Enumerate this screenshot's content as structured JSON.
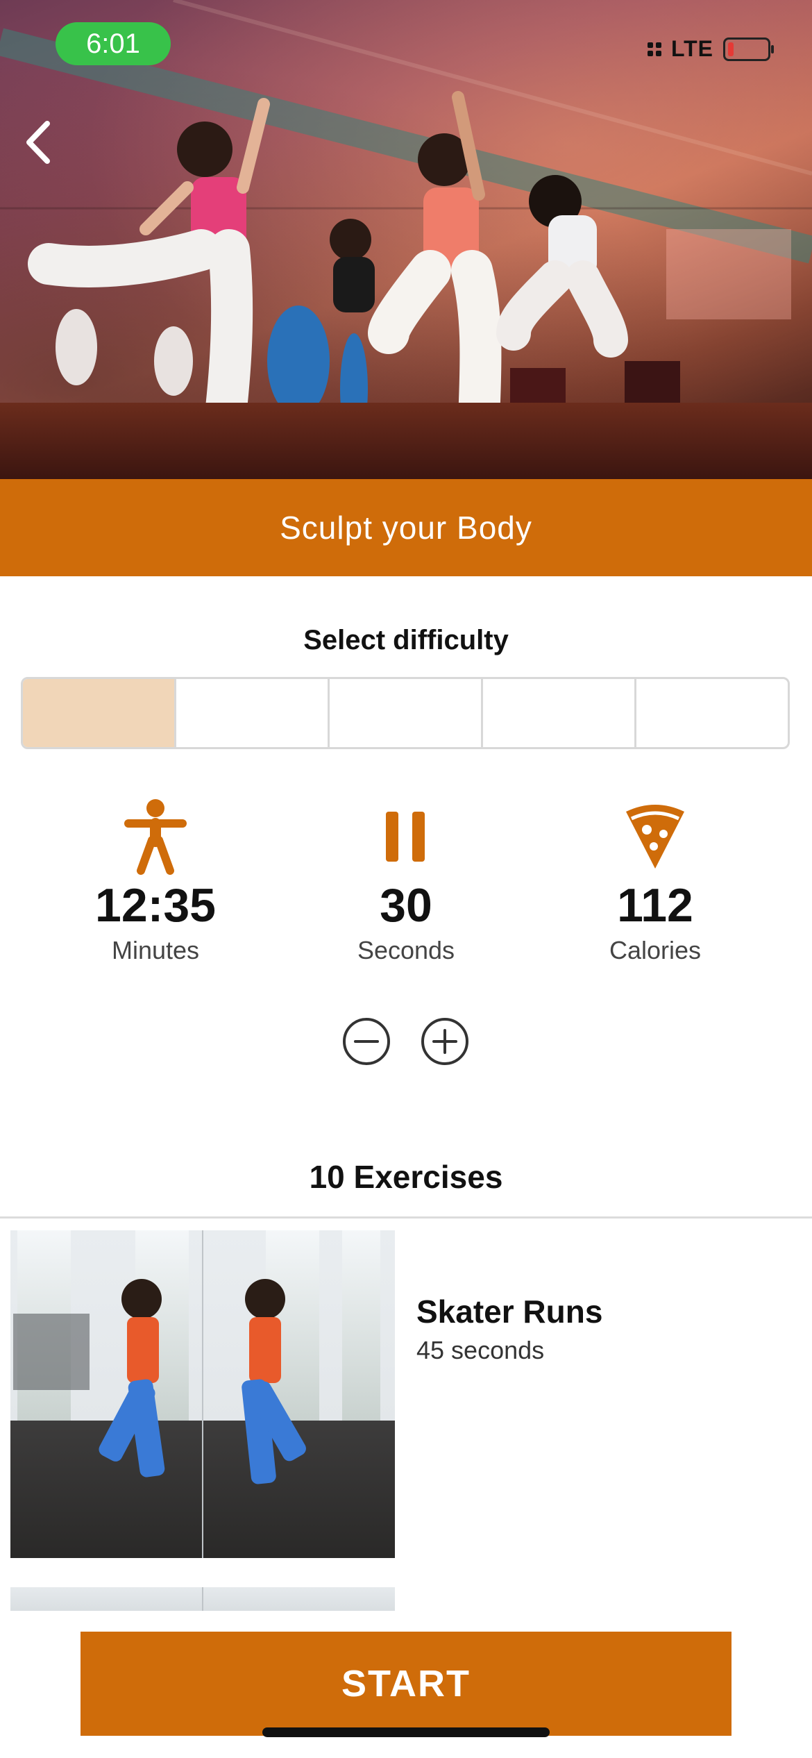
{
  "status_bar": {
    "time": "6:01",
    "network": "LTE"
  },
  "hero": {
    "back_icon": "chevron-left-icon"
  },
  "workout": {
    "title": "Sculpt your Body"
  },
  "difficulty": {
    "label": "Select difficulty",
    "levels": 5,
    "selected": 1
  },
  "stats": [
    {
      "icon": "figure-icon",
      "value": "12:35",
      "unit": "Minutes"
    },
    {
      "icon": "pause-icon",
      "value": "30",
      "unit": "Seconds"
    },
    {
      "icon": "pizza-icon",
      "value": "112",
      "unit": "Calories"
    }
  ],
  "stepper": {
    "minus_icon": "minus-circle-icon",
    "plus_icon": "plus-circle-icon"
  },
  "exercises": {
    "count_label": "10 Exercises",
    "items": [
      {
        "name": "Skater Runs",
        "duration": "45 seconds"
      }
    ]
  },
  "actions": {
    "start_label": "START"
  },
  "colors": {
    "accent": "#cf6c0a",
    "difficulty_selected": "#f1d6b8",
    "status_time_bg": "#38c24a"
  }
}
